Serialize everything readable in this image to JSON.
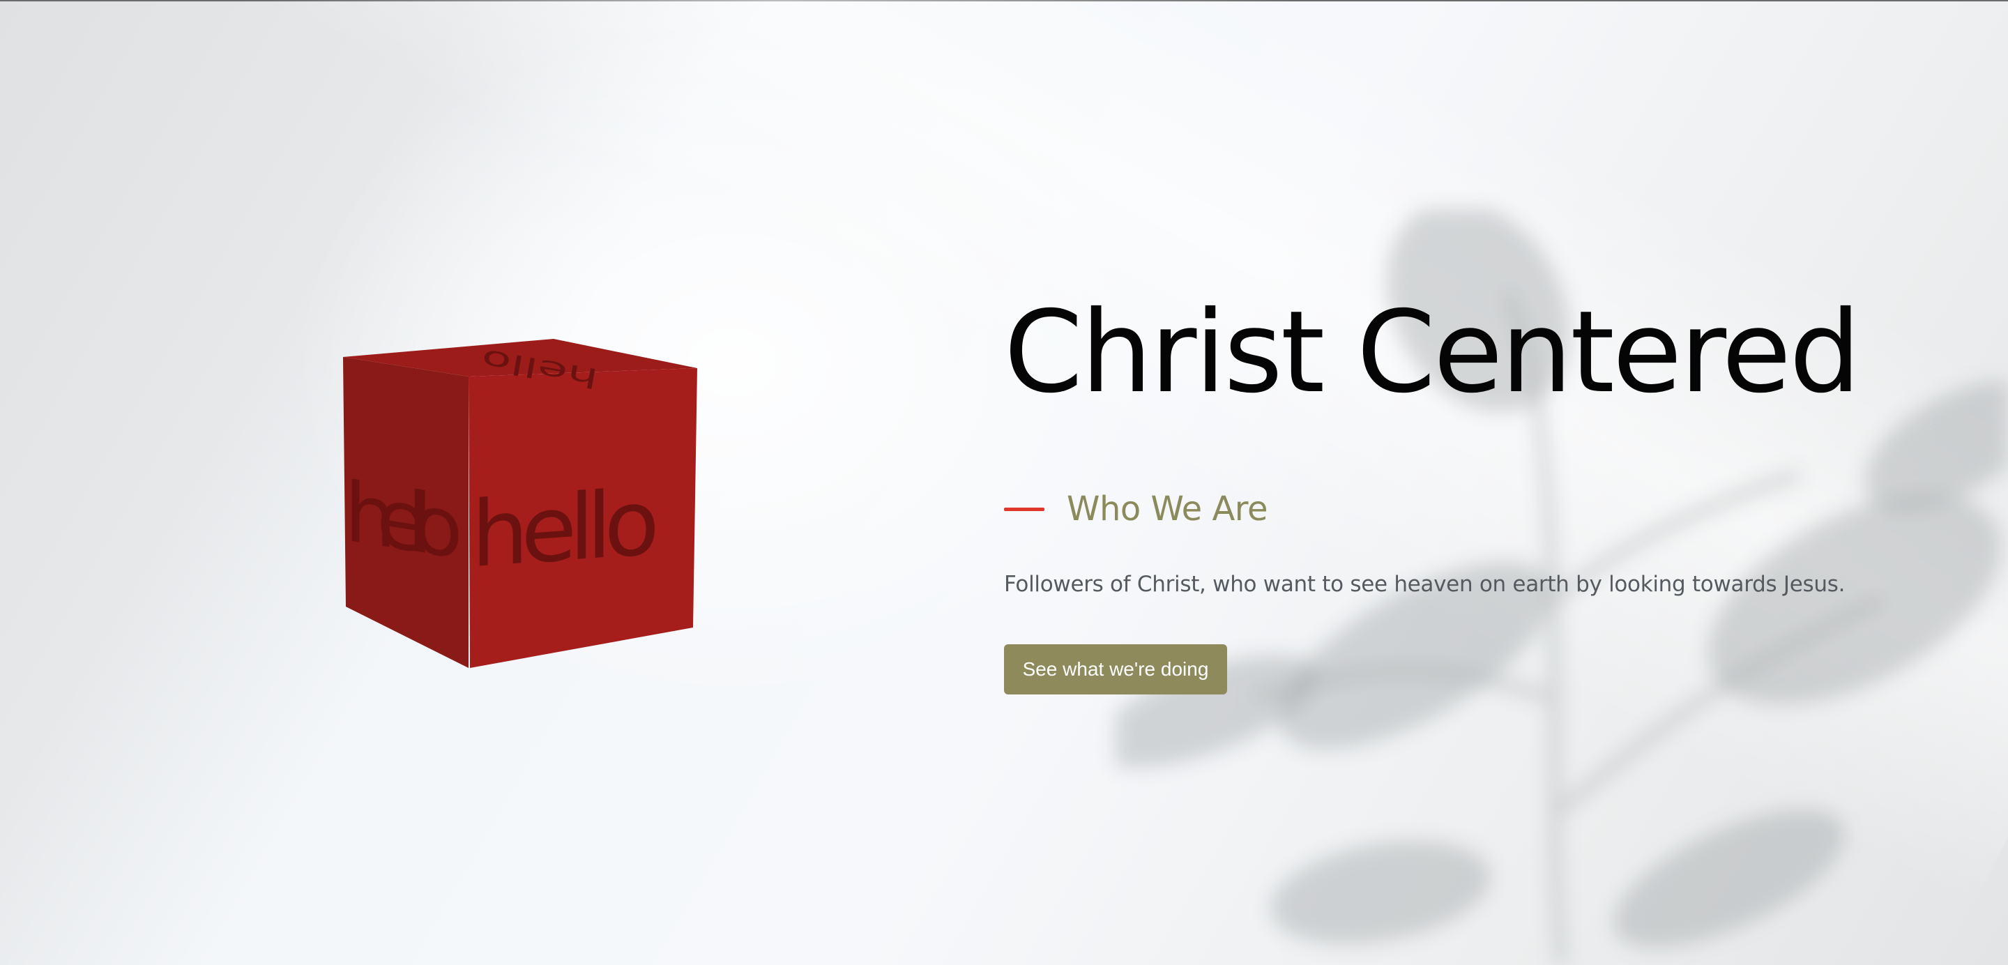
{
  "hero": {
    "title": "Christ Centered",
    "kicker": "Who We Are",
    "description": "Followers of Christ, who want to see heaven on earth by looking towards Jesus.",
    "cta_label": "See what we're doing"
  },
  "cube": {
    "face_text": "hello",
    "top_face_text": "hello",
    "colors": {
      "front": "#a61e1c",
      "left": "#8a1a17",
      "top": "#9c1c1a",
      "text": "#6b1210"
    }
  },
  "colors": {
    "accent_line": "#e0362c",
    "kicker_text": "#8a8a5a",
    "button_bg": "#8e8a5c",
    "title_text": "#050505"
  }
}
